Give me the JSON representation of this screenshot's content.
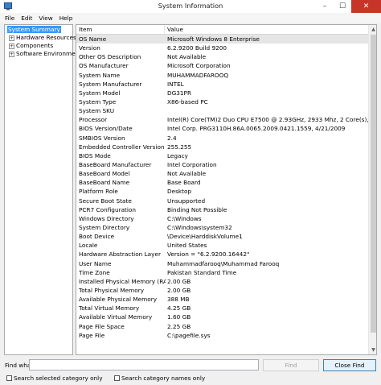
{
  "window": {
    "title": "System Information",
    "controls": {
      "minimize": "–",
      "maximize": "☐",
      "close": "✕"
    }
  },
  "menu": [
    "File",
    "Edit",
    "View",
    "Help"
  ],
  "tree": {
    "root": "System Summary",
    "children": [
      "Hardware Resources",
      "Components",
      "Software Environment"
    ]
  },
  "list": {
    "headers": {
      "item": "Item",
      "value": "Value"
    },
    "rows": [
      {
        "item": "OS Name",
        "value": "Microsoft Windows 8 Enterprise"
      },
      {
        "item": "Version",
        "value": "6.2.9200 Build 9200"
      },
      {
        "item": "Other OS Description",
        "value": "Not Available"
      },
      {
        "item": "OS Manufacturer",
        "value": "Microsoft Corporation"
      },
      {
        "item": "System Name",
        "value": "MUHAMMADFAROOQ"
      },
      {
        "item": "System Manufacturer",
        "value": "INTEL"
      },
      {
        "item": "System Model",
        "value": "DG31PR"
      },
      {
        "item": "System Type",
        "value": "X86-based PC"
      },
      {
        "item": "System SKU",
        "value": ""
      },
      {
        "item": "Processor",
        "value": "Intel(R) Core(TM)2 Duo CPU     E7500  @ 2.93GHz, 2933 Mhz, 2 Core(s), 2 Log..."
      },
      {
        "item": "BIOS Version/Date",
        "value": "Intel Corp. PRG3110H.86A.0065.2009.0421.1559, 4/21/2009"
      },
      {
        "item": "SMBIOS Version",
        "value": "2.4"
      },
      {
        "item": "Embedded Controller Version",
        "value": "255.255"
      },
      {
        "item": "BIOS Mode",
        "value": "Legacy"
      },
      {
        "item": "BaseBoard Manufacturer",
        "value": "Intel Corporation"
      },
      {
        "item": "BaseBoard Model",
        "value": "Not Available"
      },
      {
        "item": "BaseBoard Name",
        "value": "Base Board"
      },
      {
        "item": "Platform Role",
        "value": "Desktop"
      },
      {
        "item": "Secure Boot State",
        "value": "Unsupported"
      },
      {
        "item": "PCR7 Configuration",
        "value": "Binding Not Possible"
      },
      {
        "item": "Windows Directory",
        "value": "C:\\Windows"
      },
      {
        "item": "System Directory",
        "value": "C:\\Windows\\system32"
      },
      {
        "item": "Boot Device",
        "value": "\\Device\\HarddiskVolume1"
      },
      {
        "item": "Locale",
        "value": "United States"
      },
      {
        "item": "Hardware Abstraction Layer",
        "value": "Version = \"6.2.9200.16442\""
      },
      {
        "item": "User Name",
        "value": "Muhammadfarooq\\Muhammad Farooq"
      },
      {
        "item": "Time Zone",
        "value": "Pakistan Standard Time"
      },
      {
        "item": "Installed Physical Memory (RAM)",
        "value": "2.00 GB"
      },
      {
        "item": "Total Physical Memory",
        "value": "2.00 GB"
      },
      {
        "item": "Available Physical Memory",
        "value": "388 MB"
      },
      {
        "item": "Total Virtual Memory",
        "value": "4.25 GB"
      },
      {
        "item": "Available Virtual Memory",
        "value": "1.60 GB"
      },
      {
        "item": "Page File Space",
        "value": "2.25 GB"
      },
      {
        "item": "Page File",
        "value": "C:\\pagefile.sys"
      }
    ]
  },
  "find": {
    "label": "Find what:",
    "value": "",
    "find_button": "Find",
    "close_button": "Close Find",
    "search_selected": "Search selected category only",
    "search_names": "Search category names only"
  }
}
